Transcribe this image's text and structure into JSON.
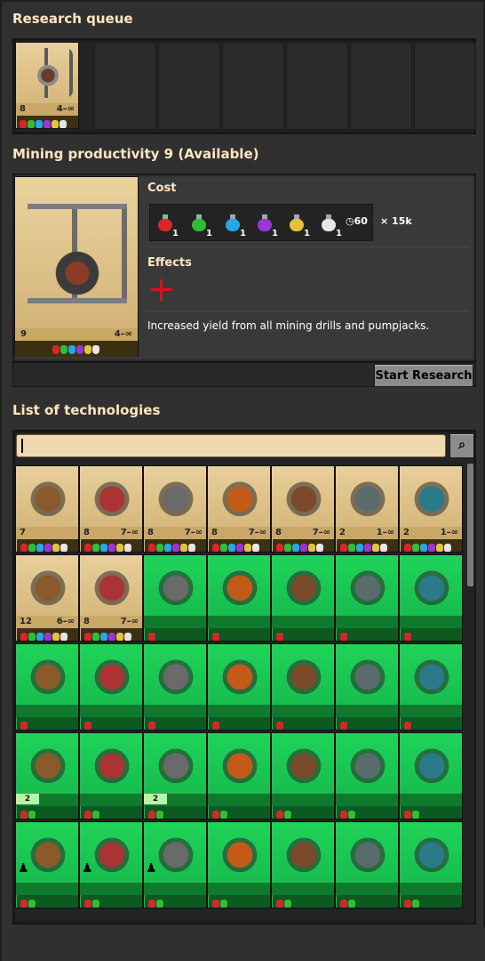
{
  "queue": {
    "title": "Research queue",
    "item": {
      "level": "8",
      "range": "4–∞",
      "icon": "mining-drill-icon"
    },
    "empty_slots": 6
  },
  "selected": {
    "title": "Mining productivity 9 (Available)",
    "level": "9",
    "range": "4–∞",
    "cost_label": "Cost",
    "packs": [
      {
        "color": "#d8262a",
        "count": "1"
      },
      {
        "color": "#2fbf34",
        "count": "1"
      },
      {
        "color": "#27a6e8",
        "count": "1"
      },
      {
        "color": "#9b35d6",
        "count": "1"
      },
      {
        "color": "#e5c23b",
        "count": "1"
      },
      {
        "color": "#e6e6e6",
        "count": "1"
      }
    ],
    "time": "60",
    "multiplier": "× 15k",
    "effects_label": "Effects",
    "effect_icon": "plus-icon",
    "description": "Increased yield from all mining drills and pumpjacks.",
    "start_button": "Start Research"
  },
  "list": {
    "title": "List of technologies",
    "search_placeholder": "",
    "search_icon": "search-icon",
    "rows": [
      [
        {
          "style": "beige",
          "icon": "artillery-shell-range-icon",
          "level": "7",
          "range": "",
          "packs": 6
        },
        {
          "style": "beige",
          "icon": "robot-speed-icon",
          "level": "8",
          "range": "7–∞",
          "packs": 6
        },
        {
          "style": "beige",
          "icon": "physical-damage-icon",
          "level": "8",
          "range": "7–∞",
          "packs": 6
        },
        {
          "style": "beige",
          "icon": "refined-flammables-icon",
          "level": "8",
          "range": "7–∞",
          "packs": 6
        },
        {
          "style": "beige",
          "icon": "stronger-explosives-icon",
          "level": "8",
          "range": "7–∞",
          "packs": 6
        },
        {
          "style": "beige",
          "icon": "artillery-speed-icon",
          "level": "2",
          "range": "1–∞",
          "packs": 6
        },
        {
          "style": "beige",
          "icon": "artillery-range-icon",
          "level": "2",
          "range": "1–∞",
          "packs": 6
        }
      ],
      [
        {
          "style": "beige",
          "icon": "worker-robot-storage-icon",
          "level": "12",
          "range": "6–∞",
          "packs": 6
        },
        {
          "style": "beige",
          "icon": "follower-robot-count-icon",
          "level": "8",
          "range": "7–∞",
          "packs": 6
        },
        {
          "style": "green",
          "icon": "electronics-icon",
          "level": "",
          "range": "",
          "packs": 1
        },
        {
          "style": "green",
          "icon": "optics-icon",
          "level": "",
          "range": "",
          "packs": 1
        },
        {
          "style": "green",
          "icon": "turrets-icon",
          "level": "",
          "range": "",
          "packs": 1
        },
        {
          "style": "green",
          "icon": "stone-wall-icon",
          "level": "",
          "range": "",
          "packs": 1
        },
        {
          "style": "green",
          "icon": "military-icon",
          "level": "",
          "range": "",
          "packs": 1
        }
      ],
      [
        {
          "style": "green",
          "icon": "logistics-icon",
          "level": "",
          "range": "",
          "packs": 1
        },
        {
          "style": "green",
          "icon": "electronics-chip-icon",
          "level": "",
          "range": "",
          "packs": 1
        },
        {
          "style": "green",
          "icon": "fast-inserter-icon",
          "level": "",
          "range": "",
          "packs": 1
        },
        {
          "style": "green",
          "icon": "automation-icon",
          "level": "",
          "range": "",
          "packs": 1
        },
        {
          "style": "green",
          "icon": "steel-processing-icon",
          "level": "",
          "range": "",
          "packs": 1
        },
        {
          "style": "green",
          "icon": "steel-axe-icon",
          "level": "",
          "range": "",
          "packs": 1
        },
        {
          "style": "green",
          "icon": "logistic-science-pack-icon",
          "level": "",
          "range": "",
          "packs": 1
        }
      ],
      [
        {
          "style": "green",
          "icon": "military-2-icon",
          "level": "",
          "range": "",
          "packs": 2,
          "badge": "2"
        },
        {
          "style": "green",
          "icon": "research-flask-icon",
          "level": "",
          "range": "",
          "packs": 2
        },
        {
          "style": "green",
          "icon": "electronics-2-icon",
          "level": "",
          "range": "",
          "packs": 2,
          "badge": "2"
        },
        {
          "style": "green",
          "icon": "gear-tree-icon",
          "level": "",
          "range": "",
          "packs": 2
        },
        {
          "style": "green",
          "icon": "landfill-icon",
          "level": "",
          "range": "",
          "packs": 2
        },
        {
          "style": "green",
          "icon": "fluid-handling-icon",
          "level": "",
          "range": "",
          "packs": 2
        },
        {
          "style": "green",
          "icon": "flammables-icon",
          "level": "",
          "range": "",
          "packs": 2
        }
      ],
      [
        {
          "style": "green",
          "icon": "engine-icon",
          "level": "",
          "range": "",
          "packs": 2,
          "locked": true
        },
        {
          "style": "green",
          "icon": "disabled-cross-icon",
          "level": "",
          "range": "",
          "packs": 2,
          "locked": true
        },
        {
          "style": "green",
          "icon": "oil-processing-icon",
          "level": "",
          "range": "",
          "packs": 2,
          "locked": true
        },
        {
          "style": "green",
          "icon": "chemical-flask-icon",
          "level": "",
          "range": "",
          "packs": 2
        },
        {
          "style": "green",
          "icon": "solar-energy-icon",
          "level": "",
          "range": "",
          "packs": 2
        },
        {
          "style": "green",
          "icon": "rail-curve-icon",
          "level": "",
          "range": "",
          "packs": 2
        },
        {
          "style": "green",
          "icon": "rail-signals-icon",
          "level": "",
          "range": "",
          "packs": 2
        }
      ]
    ],
    "pack_colors": [
      "#d8262a",
      "#2fbf34",
      "#27a6e8",
      "#9b35d6",
      "#e5c23b",
      "#e6e6e6"
    ]
  }
}
